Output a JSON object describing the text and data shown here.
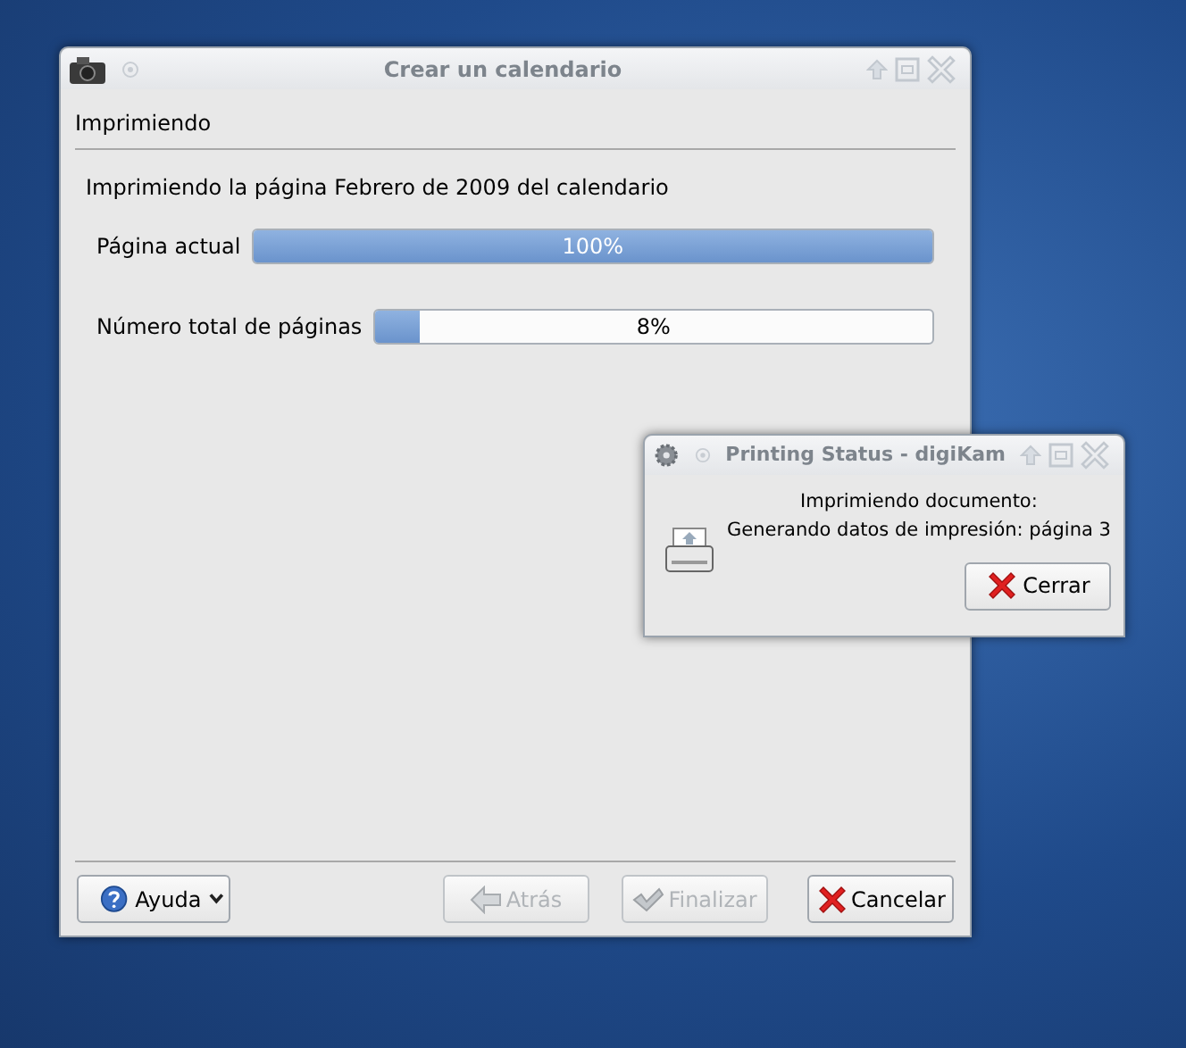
{
  "main_window": {
    "title": "Crear un calendario",
    "page_title": "Imprimiendo",
    "message": "Imprimiendo la página Febrero de 2009 del calendario",
    "progress": [
      {
        "label": "Página actual",
        "level": 1,
        "reading": "100%"
      },
      {
        "label": "Número total de páginas",
        "level": 0.08,
        "reading": "8%"
      }
    ],
    "help_button": {
      "label": "Ayuda"
    },
    "buttons": [
      {
        "label": "Atrás",
        "kind": "back",
        "disabled": true
      },
      {
        "label": "Finalizar",
        "kind": "finish",
        "disabled": true
      },
      {
        "label": "Cancelar",
        "kind": "cancel",
        "disabled": false
      }
    ]
  },
  "status_dialog": {
    "title": "Printing Status - digiKam",
    "lines": [
      "Imprimiendo documento:",
      "Generando datos de impresión: página 3"
    ],
    "button": "Cerrar"
  }
}
